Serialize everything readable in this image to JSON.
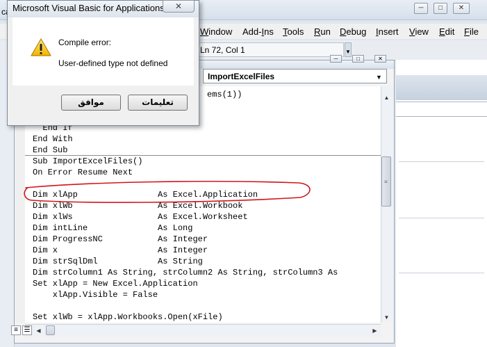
{
  "app": {
    "title_fragment": "ca",
    "window_buttons": [
      "─",
      "□",
      "✕"
    ]
  },
  "menu": [
    {
      "pre": "",
      "ul": "W",
      "post": "indow"
    },
    {
      "pre": "Add-",
      "ul": "I",
      "post": "ns"
    },
    {
      "pre": "",
      "ul": "T",
      "post": "ools"
    },
    {
      "pre": "",
      "ul": "R",
      "post": "un"
    },
    {
      "pre": "",
      "ul": "D",
      "post": "ebug"
    },
    {
      "pre": "",
      "ul": "I",
      "post": "nsert"
    },
    {
      "pre": "",
      "ul": "V",
      "post": "iew"
    },
    {
      "pre": "",
      "ul": "E",
      "post": "dit"
    },
    {
      "pre": "",
      "ul": "F",
      "post": "ile"
    }
  ],
  "toolbar": {
    "position": "Ln 72, Col 1"
  },
  "code_window": {
    "procedure": "ImportExcelFiles",
    "partial_line": "ems(1))",
    "lines": [
      "  End If",
      "End With",
      "End Sub",
      "Sub ImportExcelFiles()",
      "On Error Resume Next",
      "",
      "Dim xlApp                As Excel.Application",
      "Dim xlWb                 As Excel.Workbook",
      "Dim xlWs                 As Excel.Worksheet",
      "Dim intLine              As Long",
      "Dim ProgressNC           As Integer",
      "Dim x                    As Integer",
      "Dim strSqlDml            As String",
      "Dim strColumn1 As String, strColumn2 As String, strColumn3 As",
      "Set xlApp = New Excel.Application",
      "    xlApp.Visible = False",
      "",
      "Set xlWb = xlApp.Workbooks.Open(xFile)"
    ]
  },
  "dialog": {
    "title": "Microsoft Visual Basic for Applications",
    "close": "✕",
    "message_title": "Compile error:",
    "message": "User-defined type not defined",
    "ok_label": "موافق",
    "help_label": "تعليمات"
  },
  "colors": {
    "annotation": "#d0161b"
  }
}
